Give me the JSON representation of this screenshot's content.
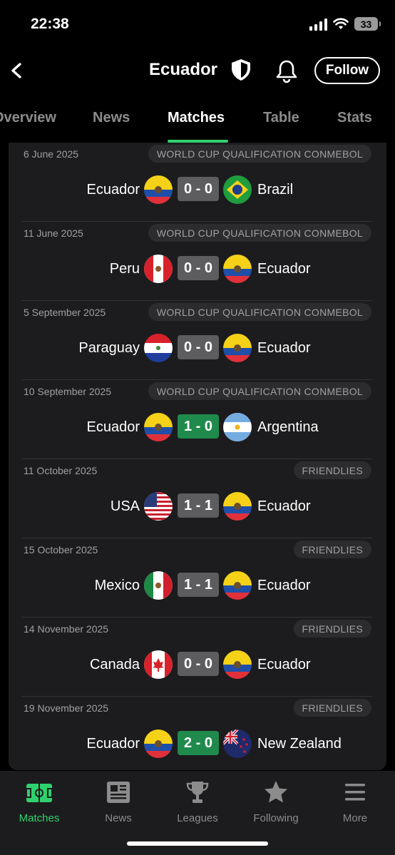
{
  "status": {
    "time": "22:38",
    "battery": "33"
  },
  "header": {
    "title": "Ecuador",
    "follow_label": "Follow"
  },
  "tabs": [
    "Overview",
    "News",
    "Matches",
    "Table",
    "Stats"
  ],
  "matches": [
    {
      "date": "6 June 2025",
      "competition": "WORLD CUP QUALIFICATION CONMEBOL",
      "home": "Ecuador",
      "score": "0 - 0",
      "away": "Brazil"
    },
    {
      "date": "11 June 2025",
      "competition": "WORLD CUP QUALIFICATION CONMEBOL",
      "home": "Peru",
      "score": "0 - 0",
      "away": "Ecuador"
    },
    {
      "date": "5 September 2025",
      "competition": "WORLD CUP QUALIFICATION CONMEBOL",
      "home": "Paraguay",
      "score": "0 - 0",
      "away": "Ecuador"
    },
    {
      "date": "10 September 2025",
      "competition": "WORLD CUP QUALIFICATION CONMEBOL",
      "home": "Ecuador",
      "score": "1 - 0",
      "away": "Argentina"
    },
    {
      "date": "11 October 2025",
      "competition": "FRIENDLIES",
      "home": "USA",
      "score": "1 - 1",
      "away": "Ecuador"
    },
    {
      "date": "15 October 2025",
      "competition": "FRIENDLIES",
      "home": "Mexico",
      "score": "1 - 1",
      "away": "Ecuador"
    },
    {
      "date": "14 November 2025",
      "competition": "FRIENDLIES",
      "home": "Canada",
      "score": "0 - 0",
      "away": "Ecuador"
    },
    {
      "date": "19 November 2025",
      "competition": "FRIENDLIES",
      "home": "Ecuador",
      "score": "2 - 0",
      "away": "New Zealand"
    }
  ],
  "nav": [
    {
      "label": "Matches",
      "icon": "pitch-icon"
    },
    {
      "label": "News",
      "icon": "newspaper-icon"
    },
    {
      "label": "Leagues",
      "icon": "trophy-icon"
    },
    {
      "label": "Following",
      "icon": "star-icon"
    },
    {
      "label": "More",
      "icon": "menu-icon"
    }
  ],
  "colors": {
    "accent": "#2fd16f",
    "win_score": "#1f8a4c",
    "draw_score": "#5d5d60",
    "card": "#1c1c1e"
  }
}
